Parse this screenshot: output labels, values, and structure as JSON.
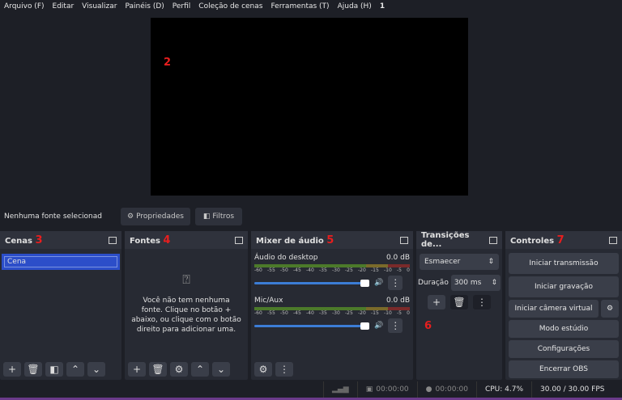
{
  "menu": [
    "Arquivo (F)",
    "Editar",
    "Visualizar",
    "Painéis (D)",
    "Perfil",
    "Coleção de cenas",
    "Ferramentas (T)",
    "Ajuda (H)"
  ],
  "annotations": [
    "1",
    "2",
    "3",
    "4",
    "5",
    "6",
    "7"
  ],
  "source_bar": {
    "label": "Nenhuma fonte selecionad",
    "properties": "Propriedades",
    "filters": "Filtros"
  },
  "scenes": {
    "title": "Cenas",
    "items": [
      "Cena"
    ]
  },
  "sources": {
    "title": "Fontes",
    "empty": "Você não tem nenhuma fonte. Clique no botão + abaixo, ou clique com o botão direito para adicionar uma."
  },
  "mixer": {
    "title": "Mixer de áudio",
    "channels": [
      {
        "name": "Áudio do desktop",
        "db": "0.0 dB",
        "volume": 1.0
      },
      {
        "name": "Mic/Aux",
        "db": "0.0 dB",
        "volume": 1.0
      }
    ],
    "scale": [
      "-60",
      "-55",
      "-50",
      "-45",
      "-40",
      "-35",
      "-30",
      "-25",
      "-20",
      "-15",
      "-10",
      "-5",
      "0"
    ]
  },
  "transitions": {
    "title": "Transições de...",
    "selected": "Esmaecer",
    "duration_label": "Duração",
    "duration": "300 ms"
  },
  "controls": {
    "title": "Controles",
    "buttons": [
      "Iniciar transmissão",
      "Iniciar gravação",
      "Iniciar câmera virtual",
      "Modo estúdio",
      "Configurações",
      "Encerrar OBS"
    ]
  },
  "status": {
    "stream_time": "00:00:00",
    "rec_time": "00:00:00",
    "cpu": "CPU: 4.7%",
    "fps": "30.00 / 30.00 FPS"
  },
  "colors": {
    "accent": "#2c4ec9",
    "annotation": "#e81e1e",
    "frame": "#6a3a8a"
  }
}
